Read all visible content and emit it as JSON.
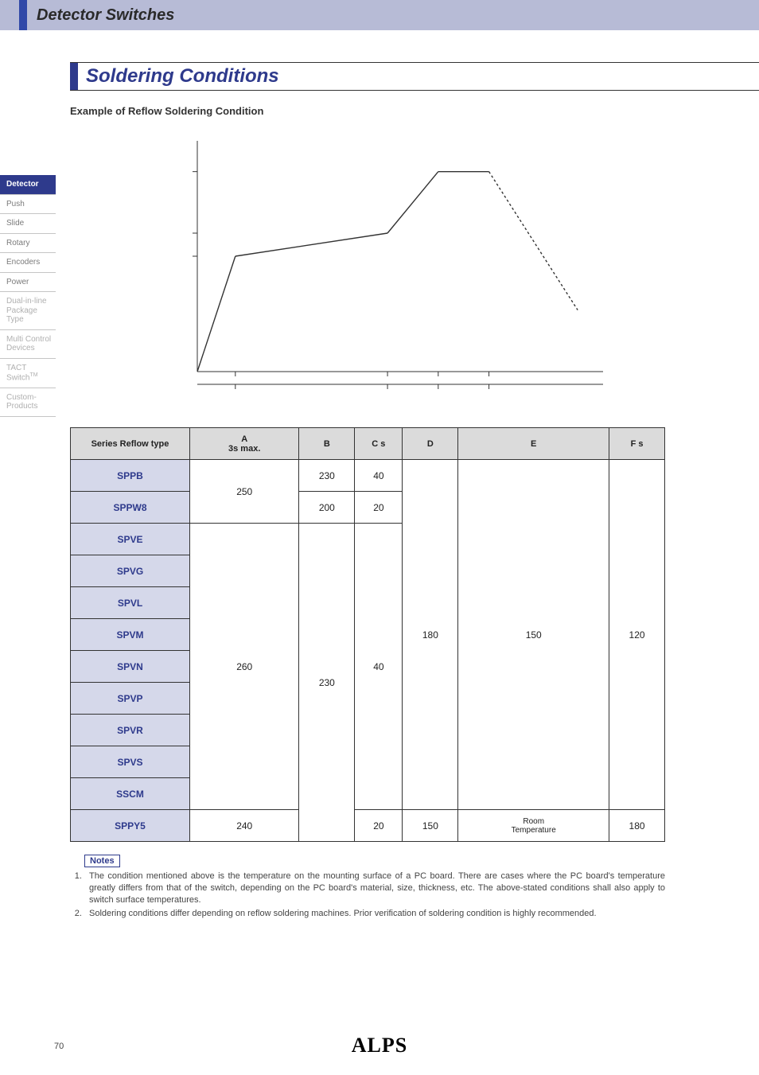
{
  "header": {
    "title": "Detector Switches"
  },
  "section": {
    "title": "Soldering Conditions",
    "subtitle": "Example of Reflow Soldering Condition"
  },
  "sidebar": {
    "items": [
      {
        "label": "Detector",
        "active": true
      },
      {
        "label": "Push"
      },
      {
        "label": "Slide"
      },
      {
        "label": "Rotary"
      },
      {
        "label": "Encoders"
      },
      {
        "label": "Power"
      },
      {
        "label": "Dual-in-line Package Type",
        "light": true
      },
      {
        "label": "Multi Control Devices",
        "light": true
      },
      {
        "label": "TACT Switch",
        "tm": true,
        "light": true
      },
      {
        "label": "Custom-Products",
        "light_alt": true
      }
    ]
  },
  "chart_data": {
    "type": "line",
    "title": "",
    "xlabel": "",
    "ylabel": "",
    "y_ticks_note": "three dashed horizontal reference levels and a baseline",
    "segments_note": "F preheat ramp, hold near D/E, ramp to peak A over C, hold 3s, cool (dashed)",
    "points": [
      {
        "x": 0,
        "y": 0
      },
      {
        "x": 30,
        "y": 150
      },
      {
        "x": 150,
        "y": 180
      },
      {
        "x": 190,
        "y": 260
      },
      {
        "x": 230,
        "y": 260
      },
      {
        "x": 300,
        "y": 80
      }
    ],
    "dashed_from_index": 4,
    "h_refs": [
      150,
      180,
      260
    ],
    "baseline": 0,
    "ylim": [
      0,
      300
    ],
    "xlim": [
      0,
      320
    ]
  },
  "table": {
    "headers": [
      "Series Reflow type",
      "A\n3s max.",
      "B",
      "C s",
      "D",
      "E",
      "F s"
    ],
    "rows": [
      {
        "series": "SPPB",
        "A": "250",
        "B": "230",
        "C": "40",
        "D": "180",
        "E": "150",
        "F": "120"
      },
      {
        "series": "SPPW8",
        "A": "250",
        "B": "200",
        "C": "20",
        "D": "180",
        "E": "150",
        "F": "120"
      },
      {
        "series": "SPVE",
        "A": "260",
        "B": "230",
        "C": "40",
        "D": "180",
        "E": "150",
        "F": "120"
      },
      {
        "series": "SPVG",
        "A": "260",
        "B": "230",
        "C": "40",
        "D": "180",
        "E": "150",
        "F": "120"
      },
      {
        "series": "SPVL",
        "A": "260",
        "B": "230",
        "C": "40",
        "D": "180",
        "E": "150",
        "F": "120"
      },
      {
        "series": "SPVM",
        "A": "260",
        "B": "230",
        "C": "40",
        "D": "180",
        "E": "150",
        "F": "120"
      },
      {
        "series": "SPVN",
        "A": "260",
        "B": "230",
        "C": "40",
        "D": "180",
        "E": "150",
        "F": "120"
      },
      {
        "series": "SPVP",
        "A": "260",
        "B": "230",
        "C": "40",
        "D": "180",
        "E": "150",
        "F": "120"
      },
      {
        "series": "SPVR",
        "A": "260",
        "B": "230",
        "C": "40",
        "D": "180",
        "E": "150",
        "F": "120"
      },
      {
        "series": "SPVS",
        "A": "260",
        "B": "230",
        "C": "40",
        "D": "180",
        "E": "150",
        "F": "120"
      },
      {
        "series": "SSCM",
        "A": "260",
        "B": "230",
        "C": "40",
        "D": "180",
        "E": "150",
        "F": "120"
      },
      {
        "series": "SPPY5",
        "A": "240",
        "B": "230",
        "C": "20",
        "D": "150",
        "E": "Room Temperature",
        "F": "180"
      }
    ],
    "display": {
      "A_groups": [
        {
          "value": "250",
          "span": 2
        },
        {
          "value": "260",
          "span": 9
        },
        {
          "value": "240",
          "span": 1
        }
      ],
      "B_groups": [
        {
          "value": "230",
          "span": 1
        },
        {
          "value": "200",
          "span": 1
        },
        {
          "value": "230",
          "span": 10
        }
      ],
      "C_groups": [
        {
          "value": "40",
          "span": 1
        },
        {
          "value": "20",
          "span": 1
        },
        {
          "value": "40",
          "span": 9
        },
        {
          "value": "20",
          "span": 1
        }
      ],
      "D_groups": [
        {
          "value": "180",
          "span": 11
        },
        {
          "value": "150",
          "span": 1
        }
      ],
      "E_groups": [
        {
          "value": "150",
          "span": 11
        },
        {
          "value": "Room\nTemperature",
          "span": 1
        }
      ],
      "F_groups": [
        {
          "value": "120",
          "span": 11
        },
        {
          "value": "180",
          "span": 1
        }
      ]
    }
  },
  "notes": {
    "label": "Notes",
    "items": [
      "The condition mentioned above is the temperature on the mounting surface of a PC board. There are cases where the PC board's temperature greatly differs from that of the switch, depending on the PC board's material, size, thickness, etc. The above-stated conditions shall also apply to switch surface temperatures.",
      "Soldering conditions differ depending on reflow soldering machines. Prior verification of soldering condition is highly recommended."
    ]
  },
  "footer": {
    "page": "70",
    "brand": "ALPS"
  }
}
